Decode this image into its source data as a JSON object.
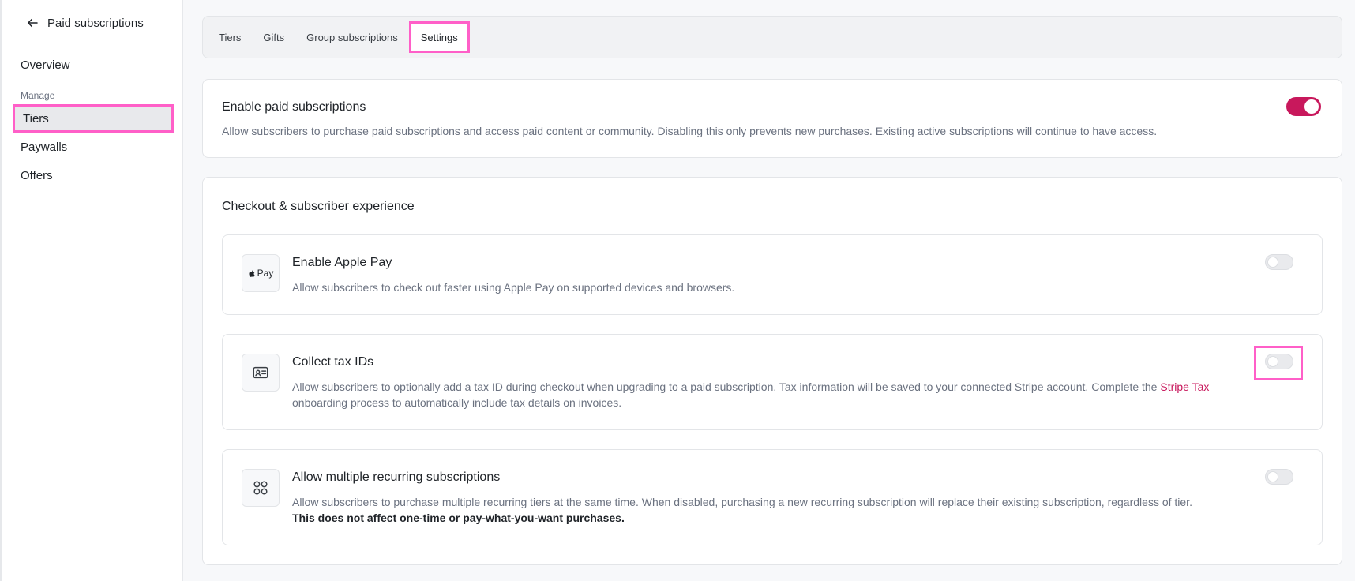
{
  "sidebar": {
    "back_label": "Paid subscriptions",
    "overview": "Overview",
    "section_label": "Manage",
    "items": [
      "Tiers",
      "Paywalls",
      "Offers"
    ]
  },
  "tabs": [
    "Tiers",
    "Gifts",
    "Group subscriptions",
    "Settings"
  ],
  "enable_card": {
    "title": "Enable paid subscriptions",
    "description": "Allow subscribers to purchase paid subscriptions and access paid content or community. Disabling this only prevents new purchases. Existing active subscriptions will continue to have access.",
    "enabled": true
  },
  "checkout": {
    "title": "Checkout & subscriber experience",
    "apple_pay": {
      "icon_text": "Pay",
      "title": "Enable Apple Pay",
      "description": "Allow subscribers to check out faster using Apple Pay on supported devices and browsers.",
      "enabled": false
    },
    "tax_ids": {
      "title": "Collect tax IDs",
      "description_before": "Allow subscribers to optionally add a tax ID during checkout when upgrading to a paid subscription. Tax information will be saved to your connected Stripe account. Complete the ",
      "link": "Stripe Tax",
      "description_after": " onboarding process to automatically include tax details on invoices.",
      "enabled": false
    },
    "multiple": {
      "title": "Allow multiple recurring subscriptions",
      "description": "Allow subscribers to purchase multiple recurring tiers at the same time. When disabled, purchasing a new recurring subscription will replace their existing subscription, regardless of tier.",
      "description_strong": "This does not affect one-time or pay-what-you-want purchases.",
      "enabled": false
    }
  },
  "colors": {
    "accent": "#c8185c",
    "highlight": "#ff5fc8"
  }
}
